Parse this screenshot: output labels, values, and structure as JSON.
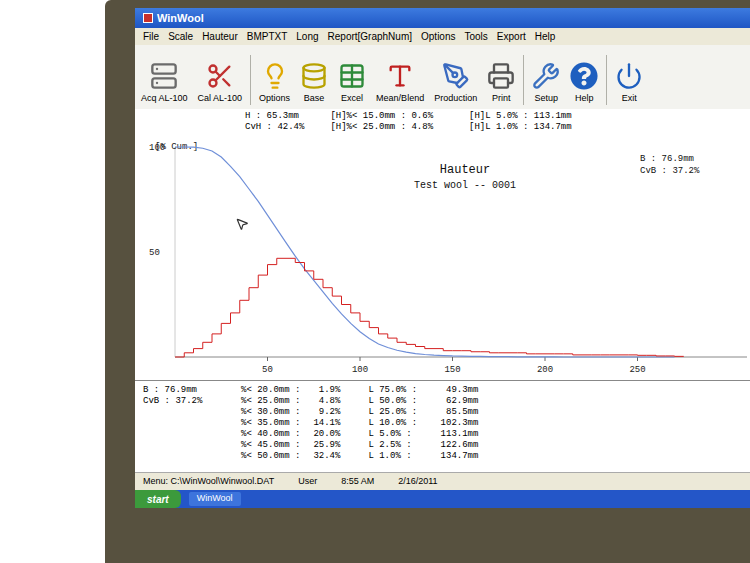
{
  "window": {
    "title": "WinWool"
  },
  "menu": [
    "File",
    "Scale",
    "Hauteur",
    "BMPTXT",
    "Long",
    "Report[GraphNum]",
    "Options",
    "Tools",
    "Export",
    "Help"
  ],
  "toolbar": [
    "Acq AL-100",
    "Cal AL-100",
    "Options",
    "Base",
    "Excel",
    "Mean/Blend",
    "Production",
    "Print",
    "Setup",
    "Help",
    "Exit"
  ],
  "summary": {
    "left": [
      "H : 65.3mm",
      "CvH : 42.4%"
    ],
    "middle": [
      "[H]%< 15.0mm : 0.6%",
      "[H]%< 25.0mm : 4.8%"
    ],
    "right": [
      "[H]L 5.0% : 113.1mm",
      "[H]L 1.0% : 134.7mm"
    ]
  },
  "chart": {
    "y_label": "[% Cum.]",
    "title": "Hauteur",
    "subtitle": "Test wool -- 0001",
    "stats": [
      "B : 76.9mm",
      "CvB : 37.2%"
    ],
    "x_ticks": [
      "50",
      "100",
      "150",
      "200",
      "250"
    ],
    "y_ticks": [
      "100",
      "50"
    ],
    "series": [
      {
        "kind": "line",
        "color": "#6f8fd8",
        "values": [
          100,
          100,
          99.9,
          99.4,
          98.1,
          95.2,
          90.8,
          85.9,
          80,
          74.1,
          67.6,
          61,
          54.5,
          48,
          42,
          36.5,
          31,
          25.5,
          20.5,
          16,
          12,
          8.8,
          6.2,
          4.5,
          3.2,
          2.3,
          1.6,
          1.2,
          0.9,
          0.7,
          0.5,
          0.4,
          0.3,
          0.3,
          0.2,
          0.2,
          0.2,
          0.1,
          0.1,
          0.1,
          0.1,
          0.1,
          0,
          0,
          0,
          0,
          0,
          0,
          0,
          0,
          0,
          0,
          0,
          0,
          0
        ]
      },
      {
        "kind": "steps",
        "color": "#d42020",
        "values": [
          0,
          2,
          4,
          7,
          11,
          16,
          21,
          27,
          33,
          39,
          44,
          47,
          47,
          45,
          41,
          37,
          33,
          29,
          25,
          21,
          17,
          14,
          11,
          9,
          7,
          6,
          5,
          4,
          4,
          3,
          3,
          3,
          2.5,
          2.5,
          2,
          2,
          2,
          2,
          1.5,
          1.5,
          1.5,
          1.5,
          1.5,
          1,
          1,
          1,
          1,
          1,
          1,
          1,
          0.8,
          0.8,
          0.5,
          0.5,
          0.3
        ]
      }
    ]
  },
  "results": {
    "stats": [
      "B : 76.9mm",
      "CvB : 37.2%"
    ],
    "short": [
      {
        "label": "%< 20.0mm :",
        "value": "1.9%"
      },
      {
        "label": "%< 25.0mm :",
        "value": "4.8%"
      },
      {
        "label": "%< 30.0mm :",
        "value": "9.2%"
      },
      {
        "label": "%< 35.0mm :",
        "value": "14.1%"
      },
      {
        "label": "%< 40.0mm :",
        "value": "20.0%"
      },
      {
        "label": "%< 45.0mm :",
        "value": "25.9%"
      },
      {
        "label": "%< 50.0mm :",
        "value": "32.4%"
      }
    ],
    "long": [
      {
        "label": "L 75.0% :",
        "value": "49.3mm"
      },
      {
        "label": "L 50.0% :",
        "value": "62.9mm"
      },
      {
        "label": "L 25.0% :",
        "value": "85.5mm"
      },
      {
        "label": "L 10.0% :",
        "value": "102.3mm"
      },
      {
        "label": "L 5.0% :",
        "value": "113.1mm"
      },
      {
        "label": "L 2.5% :",
        "value": "122.6mm"
      },
      {
        "label": "L 1.0% :",
        "value": "134.7mm"
      }
    ]
  },
  "status_bar": {
    "path": "Menu: C:\\WinWool\\Winwool.DAT",
    "user": "User",
    "time": "8:55 AM",
    "date": "2/16/2011"
  },
  "taskbar": {
    "start": "start",
    "windows": [
      "WinWool"
    ]
  }
}
